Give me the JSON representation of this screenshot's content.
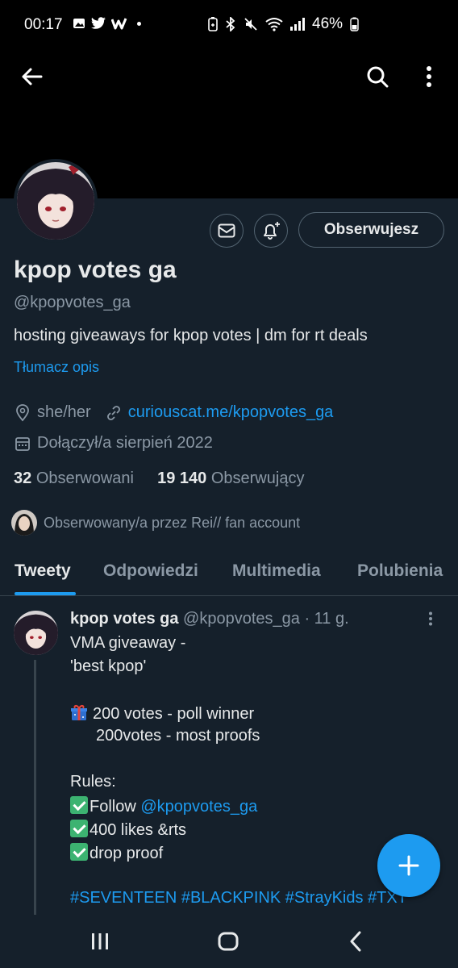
{
  "status_bar": {
    "time": "00:17",
    "battery": "46%"
  },
  "header": {
    "back_icon": "arrow-left-icon",
    "search_icon": "search-icon",
    "more_icon": "more-vertical-icon"
  },
  "profile": {
    "name": "kpop votes ga",
    "handle": "@kpopvotes_ga",
    "bio": "hosting giveaways for kpop votes | dm for rt deals",
    "translate_label": "Tłumacz opis",
    "pronouns": "she/her",
    "link": "curiouscat.me/kpopvotes_ga",
    "joined": "Dołączył/a sierpień 2022",
    "following_count": "32",
    "following_label": "Obserwowani",
    "followers_count": "19 140",
    "followers_label": "Obserwujący",
    "followed_by": "Obserwowany/a przez Rei// fan account",
    "follow_button": "Obserwujesz"
  },
  "tabs": [
    {
      "label": "Tweety",
      "active": true
    },
    {
      "label": "Odpowiedzi",
      "active": false
    },
    {
      "label": "Multimedia",
      "active": false
    },
    {
      "label": "Polubienia",
      "active": false
    }
  ],
  "tweet": {
    "name": "kpop votes ga",
    "handle": "@kpopvotes_ga",
    "time": "· 11 g.",
    "lines": {
      "l1": "VMA giveaway -",
      "l2": "'best kpop'",
      "l3": "200 votes - poll winner",
      "l4": "200votes - most proofs",
      "l5": "Rules:",
      "l6_prefix": "Follow ",
      "l6_link": "@kpopvotes_ga",
      "l7": "400 likes &rts",
      "l8": "drop proof",
      "hashtags": "#SEVENTEEN #BLACKPINK #StrayKids #TXT"
    }
  },
  "colors": {
    "background": "#15202b",
    "accent": "#1d9bf0",
    "secondary_text": "#8b98a5"
  }
}
